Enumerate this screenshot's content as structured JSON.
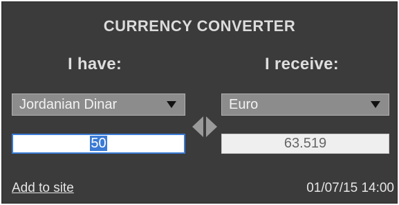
{
  "widget": {
    "title": "CURRENCY CONVERTER",
    "have_label": "I have:",
    "receive_label": "I receive:",
    "from_currency": "Jordanian Dinar",
    "to_currency": "Euro",
    "amount_input": "50",
    "result_value": "63.519",
    "add_link": "Add to site",
    "timestamp": "01/07/15 14:00",
    "icons": {
      "dropdown": "triangle-down-icon",
      "swap": "swap-arrows-icon"
    },
    "colors": {
      "background": "#3b3b3b",
      "select_bg": "#8c8c8c",
      "input_focus": "#3a7bd5",
      "text": "#dcdcdc"
    }
  }
}
